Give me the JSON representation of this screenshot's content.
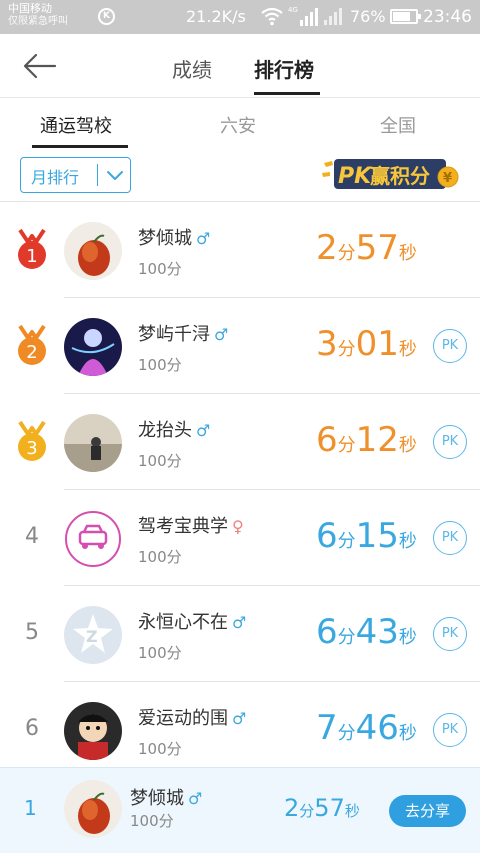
{
  "status_bar": {
    "carrier": "中国移动",
    "carrier_sub": "仅限紧急呼叫",
    "sync_icon_letter": "K",
    "net_speed": "21.2K/s",
    "network_type": "4G",
    "battery": "76%",
    "battery_level": 0.76,
    "time": "23:46"
  },
  "header": {
    "tabs": [
      "成绩",
      "排行榜"
    ],
    "active_tab": "排行榜"
  },
  "scope_tabs": {
    "items": [
      "通运驾校",
      "六安",
      "全国"
    ],
    "active": "通运驾校"
  },
  "filter": {
    "period_label": "月排行"
  },
  "pk_badge": {
    "text_pk": "PK",
    "text_rest": "赢积分"
  },
  "ranking": [
    {
      "rank": "1",
      "name": "梦倾城",
      "gender": "♂",
      "score": "100分",
      "min": "2",
      "sec": "57",
      "min_unit": "分",
      "sec_unit": "秒",
      "pk": ""
    },
    {
      "rank": "2",
      "name": "梦屿千浔",
      "gender": "♂",
      "score": "100分",
      "min": "3",
      "sec": "01",
      "min_unit": "分",
      "sec_unit": "秒",
      "pk": "PK"
    },
    {
      "rank": "3",
      "name": "龙抬头",
      "gender": "♂",
      "score": "100分",
      "min": "6",
      "sec": "12",
      "min_unit": "分",
      "sec_unit": "秒",
      "pk": "PK"
    },
    {
      "rank": "4",
      "name": "驾考宝典学",
      "gender": "♀",
      "score": "100分",
      "min": "6",
      "sec": "15",
      "min_unit": "分",
      "sec_unit": "秒",
      "pk": "PK"
    },
    {
      "rank": "5",
      "name": "永恒心不在",
      "gender": "♂",
      "score": "100分",
      "min": "6",
      "sec": "43",
      "min_unit": "分",
      "sec_unit": "秒",
      "pk": "PK"
    },
    {
      "rank": "6",
      "name": "爱运动的围",
      "gender": "♂",
      "score": "100分",
      "min": "7",
      "sec": "46",
      "min_unit": "分",
      "sec_unit": "秒",
      "pk": "PK"
    }
  ],
  "my_entry": {
    "rank": "1",
    "name": "梦倾城",
    "gender": "♂",
    "score": "100分",
    "min": "2",
    "sec": "57",
    "min_unit": "分",
    "sec_unit": "秒",
    "share_label": "去分享"
  },
  "colors": {
    "accent_blue": "#3aa8e0",
    "time_orange": "#f0902a",
    "medal_gold": "#f2b01e",
    "medal_orange": "#f08a24",
    "medal_red": "#e23a2a"
  }
}
